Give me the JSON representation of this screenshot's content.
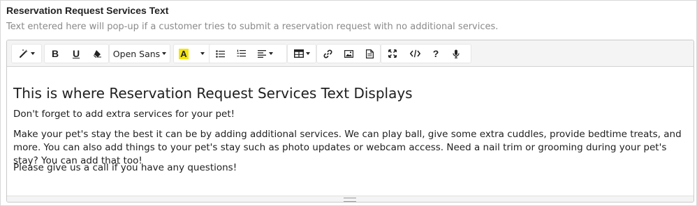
{
  "field": {
    "label": "Reservation Request Services Text",
    "help": "Text entered here will pop-up if a customer tries to submit a reservation request with no additional services."
  },
  "toolbar": {
    "style_icon": "magic-wand-icon",
    "bold_label": "B",
    "underline_label": "U",
    "eraser_icon": "eraser-icon",
    "font_family_value": "Open Sans",
    "highlight_label": "A",
    "highlight_color": "#f5e60b",
    "unordered_list_icon": "bullet-list-icon",
    "ordered_list_icon": "numbered-list-icon",
    "paragraph_icon": "align-left-icon",
    "table_icon": "table-icon",
    "link_icon": "link-icon",
    "picture_icon": "picture-icon",
    "file_icon": "file-icon",
    "fullscreen_icon": "expand-icon",
    "codeview_icon": "code-icon",
    "help_label": "?",
    "microphone_icon": "microphone-icon"
  },
  "content": {
    "heading": "This is where Reservation Request Services Text Displays",
    "p1": "Don't forget to add extra services for your pet!",
    "p2": "Make your pet's stay the best it can be by adding additional services. We can play ball, give some extra cuddles, provide bedtime treats, and more. You can also add things to your pet's stay such as photo updates or webcam access. Need a nail trim or grooming during your pet's stay? You can add that too!",
    "p3": "Please give us a call if you have any questions!"
  }
}
